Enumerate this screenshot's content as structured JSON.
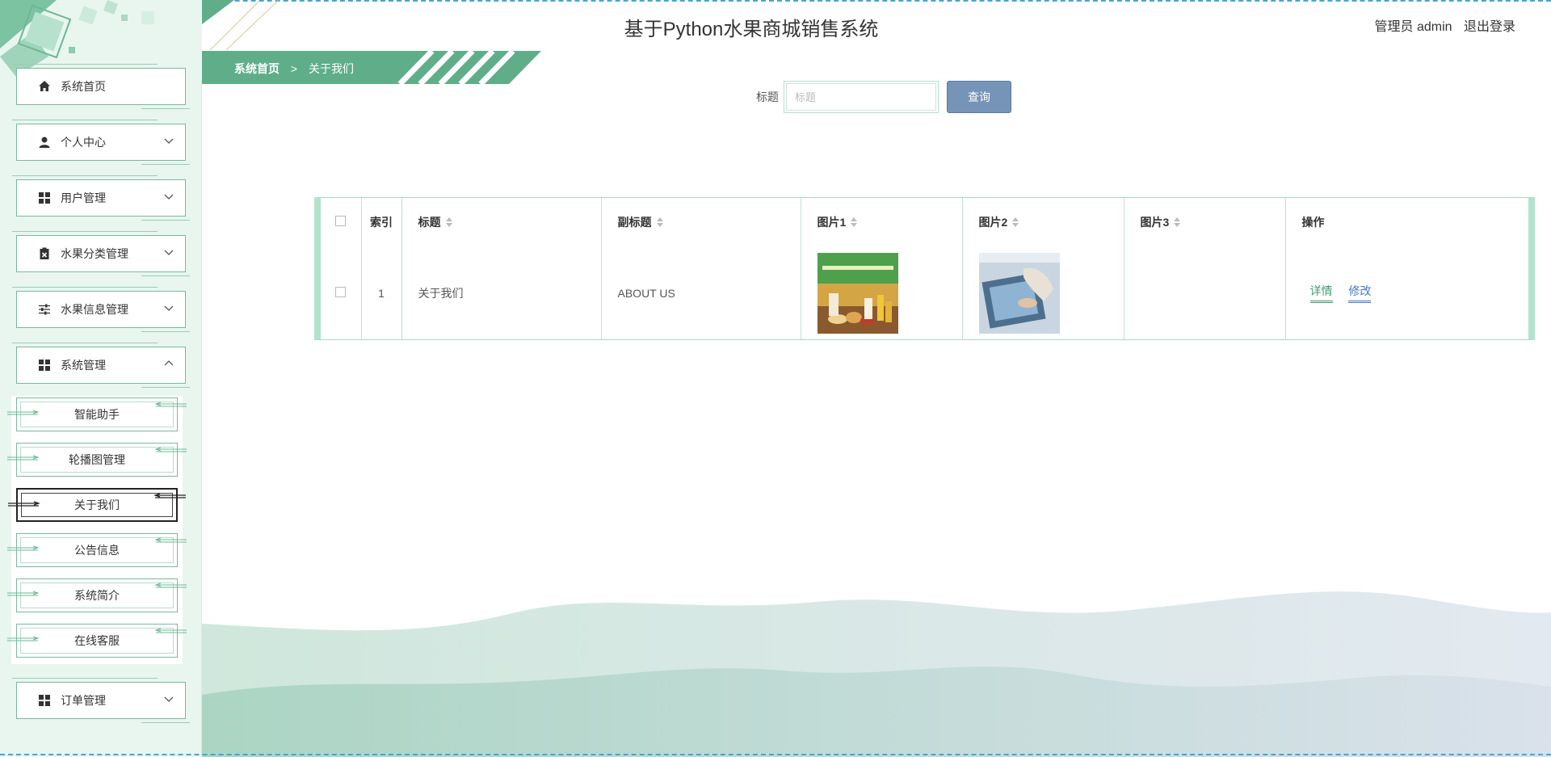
{
  "header": {
    "title": "基于Python水果商城销售系统",
    "user_label": "管理员 admin",
    "logout_label": "退出登录"
  },
  "breadcrumb": {
    "home": "系统首页",
    "separator": ">",
    "current": "关于我们"
  },
  "sidebar": {
    "items": [
      {
        "label": "系统首页",
        "icon": "home-icon"
      },
      {
        "label": "个人中心",
        "icon": "user-icon"
      },
      {
        "label": "用户管理",
        "icon": "grid-icon"
      },
      {
        "label": "水果分类管理",
        "icon": "clipboard-icon"
      },
      {
        "label": "水果信息管理",
        "icon": "sliders-icon"
      },
      {
        "label": "系统管理",
        "icon": "grid-icon"
      },
      {
        "label": "订单管理",
        "icon": "grid-icon"
      }
    ],
    "submenu": [
      {
        "label": "智能助手"
      },
      {
        "label": "轮播图管理"
      },
      {
        "label": "关于我们"
      },
      {
        "label": "公告信息"
      },
      {
        "label": "系统简介"
      },
      {
        "label": "在线客服"
      }
    ]
  },
  "search": {
    "label": "标题",
    "placeholder": "标题",
    "value": "",
    "button_label": "查询"
  },
  "table": {
    "headers": {
      "index": "索引",
      "title": "标题",
      "subtitle": "副标题",
      "image1": "图片1",
      "image2": "图片2",
      "image3": "图片3",
      "actions": "操作"
    },
    "rows": [
      {
        "index": "1",
        "title": "关于我们",
        "subtitle": "ABOUT US",
        "image1": "grain-and-oil-products-image",
        "image2": "tablet-business-image",
        "image3": "",
        "detail_label": "详情",
        "edit_label": "修改"
      }
    ]
  },
  "colors": {
    "sidebar_bg": "#e8f6ef",
    "accent_green": "#5fae89",
    "search_button": "#7694b8",
    "dash_blue": "#4aa3d6"
  }
}
